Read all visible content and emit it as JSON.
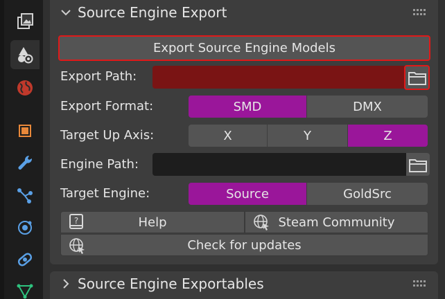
{
  "tabs": [
    {
      "name": "render-layer-icon",
      "active": false
    },
    {
      "name": "scene-shapes-icon",
      "active": true
    },
    {
      "name": "world-icon",
      "active": false
    },
    {
      "name": "object-icon",
      "active": false
    },
    {
      "name": "wrench-modifier-icon",
      "active": false
    },
    {
      "name": "particles-icon",
      "active": false
    },
    {
      "name": "physics-icon",
      "active": false
    },
    {
      "name": "constraints-icon",
      "active": false
    },
    {
      "name": "mesh-data-icon",
      "active": false
    }
  ],
  "export_panel": {
    "title": "Source Engine Export",
    "export_button": "Export Source Engine Models",
    "export_path": {
      "label": "Export Path:",
      "value": ""
    },
    "export_format": {
      "label": "Export Format:",
      "options": [
        "SMD",
        "DMX"
      ],
      "selected": "SMD"
    },
    "up_axis": {
      "label": "Target Up Axis:",
      "options": [
        "X",
        "Y",
        "Z"
      ],
      "selected": "Z"
    },
    "engine_path": {
      "label": "Engine Path:",
      "value": ""
    },
    "target_engine": {
      "label": "Target Engine:",
      "options": [
        "Source",
        "GoldSrc"
      ],
      "selected": "Source"
    },
    "help_button": "Help",
    "steam_button": "Steam Community",
    "updates_button": "Check for updates"
  },
  "exportables_panel": {
    "title": "Source Engine Exportables"
  },
  "colors": {
    "accent": "#9a169a",
    "error_field": "#7a1414",
    "highlight_border": "#e01919"
  }
}
